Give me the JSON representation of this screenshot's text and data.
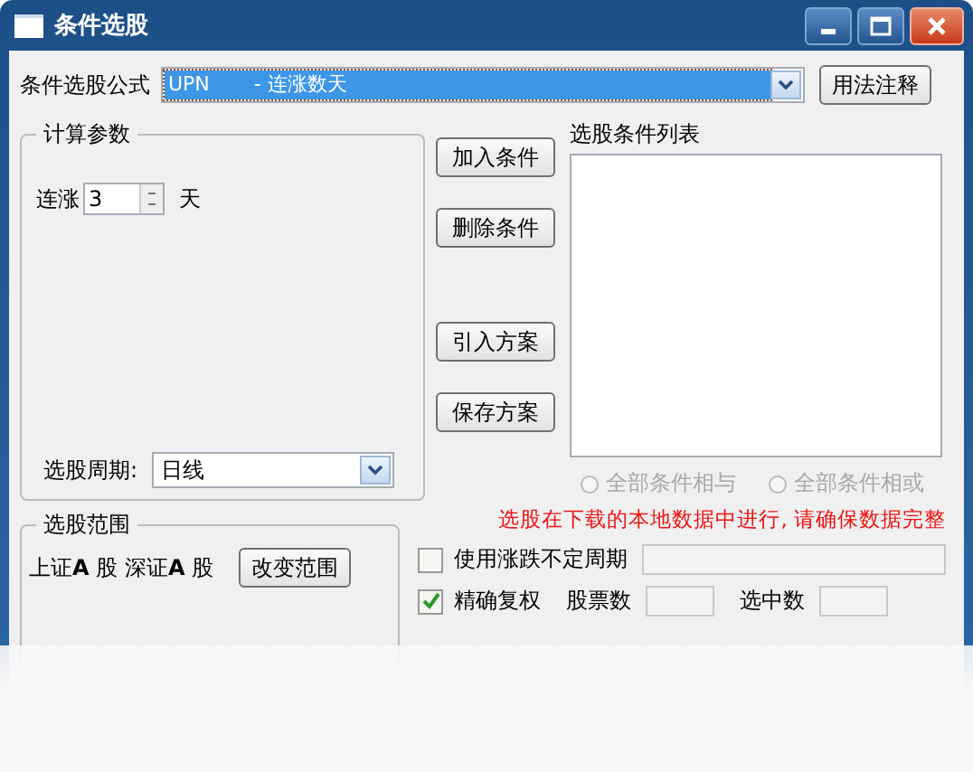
{
  "window": {
    "title": "条件选股"
  },
  "formula": {
    "label": "条件选股公式",
    "value": "UPN       - 连涨数天",
    "help_button": "用法注释"
  },
  "params": {
    "title": "计算参数",
    "prefix": "连涨",
    "value": "3",
    "suffix": "天",
    "period_label": "选股周期:",
    "period_value": "日线"
  },
  "actions": [
    "加入条件",
    "删除条件",
    "引入方案",
    "保存方案"
  ],
  "conditions": {
    "label": "选股条件列表"
  },
  "logic": [
    {
      "label": "全部条件相与",
      "selected": false,
      "disabled": true
    },
    {
      "label": "全部条件相或",
      "selected": false,
      "disabled": true
    }
  ],
  "notice": "选股在下载的本地数据中进行, 请确保数据完整",
  "range": {
    "title": "选股范围",
    "value": "上证**A** 股 深证**A** 股",
    "button": "改变范围"
  },
  "options": [
    {
      "label": "使用涨跌不定周期",
      "checked": false
    },
    {
      "label": "精确复权",
      "checked": true
    }
  ],
  "counts": [
    {
      "label": "股票数"
    },
    {
      "label": "选中数"
    }
  ]
}
